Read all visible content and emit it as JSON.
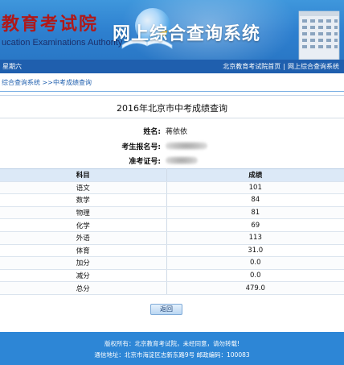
{
  "header": {
    "logo_cn": "教育考试院",
    "logo_en": "ucation Examinations Authority",
    "site_title": "网上综合查询系统"
  },
  "nav": {
    "weekday": "星期六",
    "link_home": "北京教育考试院首页",
    "separator": "|",
    "link_query": "网上综合查询系统"
  },
  "breadcrumb": {
    "text": "综合查询系统 >>中考成绩查询"
  },
  "result": {
    "title": "2016年北京市中考成绩查询",
    "name_label": "姓名:",
    "name_value": "蒋依依",
    "exam_no_label": "考生报名号:",
    "ticket_label": "准考证号:"
  },
  "table": {
    "headers": [
      "科目",
      "成绩"
    ],
    "rows": [
      {
        "subject": "语文",
        "score": "101"
      },
      {
        "subject": "数学",
        "score": "84"
      },
      {
        "subject": "物理",
        "score": "81"
      },
      {
        "subject": "化学",
        "score": "69"
      },
      {
        "subject": "外语",
        "score": "113"
      },
      {
        "subject": "体育",
        "score": "31.0"
      },
      {
        "subject": "加分",
        "score": "0.0"
      },
      {
        "subject": "减分",
        "score": "0.0"
      },
      {
        "subject": "总分",
        "score": "479.0"
      }
    ]
  },
  "back_button": {
    "label": "返回"
  },
  "footer": {
    "line1": "版权所有：北京教育考试院，未经同意，请勿转载!",
    "line2": "通信地址：北京市海淀区志新东路9号 邮政编码：100083"
  },
  "colors": {
    "header_blue": "#2d7fcf",
    "nav_blue": "#1f5fae",
    "logo_red": "#b01818",
    "table_header": "#dce9f7",
    "footer_blue": "#2d86d6"
  }
}
